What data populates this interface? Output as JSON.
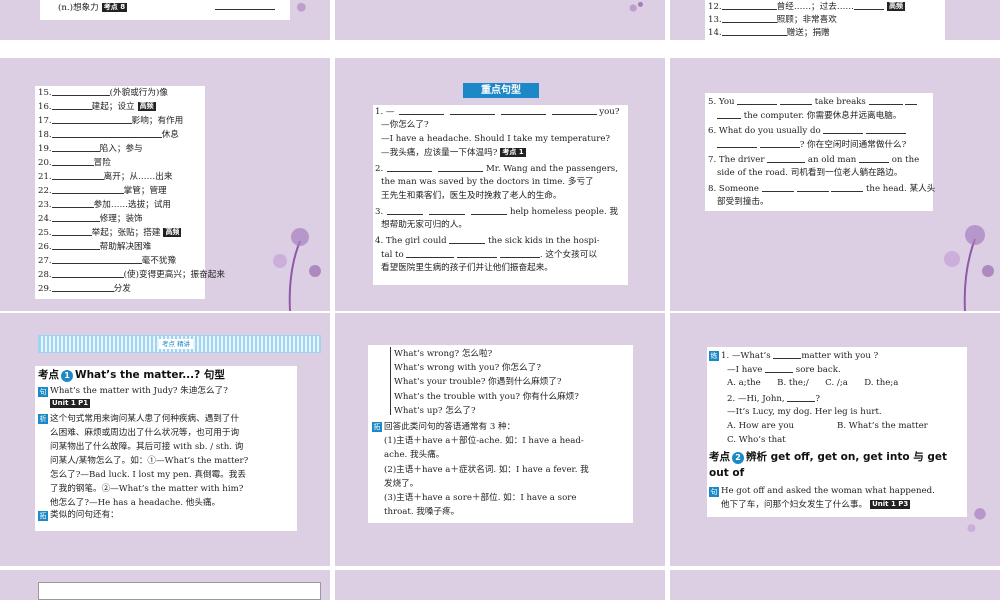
{
  "colors": {
    "slide_bg": "#dccfe3",
    "accent_blue": "#1d88c8",
    "deco_purple": "#8e5aa8"
  },
  "slide1": {
    "line_a": "(n.)想象力",
    "tag_a": "考点 8"
  },
  "slide3": {
    "l12": "12.",
    "l12_text": "曾经……；过去……",
    "l12_tag": "高频",
    "l13": "13.",
    "l13_text": "照顾；非常喜欢",
    "l14": "14.",
    "l14_text": "赠送；捐赠"
  },
  "slide4": {
    "items": [
      {
        "n": "15.",
        "text": "(外貌或行为)像"
      },
      {
        "n": "16.",
        "text": "建起；设立",
        "tag": "高频"
      },
      {
        "n": "17.",
        "text": "影响；有作用"
      },
      {
        "n": "18.",
        "text": "休息"
      },
      {
        "n": "19.",
        "text": "陷入；参与"
      },
      {
        "n": "20.",
        "text": "冒险"
      },
      {
        "n": "21.",
        "text": "离开；从……出来"
      },
      {
        "n": "22.",
        "text": "掌管；管理"
      },
      {
        "n": "23.",
        "text": "参加……选拔；试用"
      },
      {
        "n": "24.",
        "text": "修理；装饰"
      },
      {
        "n": "25.",
        "text": "举起；张贴；搭建",
        "tag": "高频"
      },
      {
        "n": "26.",
        "text": "帮助解决困难"
      },
      {
        "n": "27.",
        "text": "毫不犹豫"
      },
      {
        "n": "28.",
        "text": "(使)变得更高兴；振奋起来"
      },
      {
        "n": "29.",
        "text": "分发"
      }
    ]
  },
  "slide5": {
    "section_title": "重点句型",
    "s1_a": "1. —",
    "s1_b": "you?",
    "s1_c": "—你怎么了?",
    "s1_d": "—I have a headache. Should I take my temperature?",
    "s1_e": "—我头痛，应该量一下体温吗?",
    "s1_tag": "考点 1",
    "s2_a": "2.",
    "s2_b": "Mr. Wang and the passengers,",
    "s2_c": "the man was saved by the doctors in time. 多亏了",
    "s2_d": "王先生和乘客们，医生及时挽救了老人的生命。",
    "s3_a": "3.",
    "s3_b": "help homeless people. 我",
    "s3_c": "想帮助无家可归的人。",
    "s4_a": "4. The girl could",
    "s4_b": "the sick kids in the hospi-",
    "s4_c": "tal to",
    "s4_d": ". 这个女孩可以",
    "s4_e": "看望医院里生病的孩子们并让他们振奋起来。"
  },
  "slide6": {
    "s5_a": "5. You",
    "s5_b": "take breaks",
    "s5_c": "the computer. 你需要休息并远离电脑。",
    "s6_a": "6. What do you usually do",
    "s6_b": "? 你在空闲时间通常做什么?",
    "s7_a": "7. The driver",
    "s7_b": "an old man",
    "s7_c": "on the",
    "s7_d": "side of the road. 司机看到一位老人躺在路边。",
    "s8_a": "8. Someone",
    "s8_b": "the head. 某人头",
    "s8_c": "部受到撞击。"
  },
  "slide7": {
    "banner_label": "考点 精讲",
    "point_title_a": "考点",
    "point_num": "1",
    "point_title_b": "What’s the matter...? 句型",
    "ex_icon": "句",
    "ex_text": "What’s the matter with Judy? 朱迪怎么了?",
    "ex_tag": "Unit 1 P1",
    "an_icon": "析",
    "an_lines": [
      "这个句式常用来询问某人患了何种疾病、遇到了什",
      "么困难、麻烦或周边出了什么状况等，也可用于询",
      "问某物出了什么故障。其后可接 with sb. / sth. 询",
      "问某人/某物怎么了。如：①—What’s the matter?",
      "怎么了?—Bad luck. I lost my pen. 真倒霉。我丢",
      "了我的钢笔。②—What’s the matter with him?",
      "他怎么了?—He has a headache. 他头痛。"
    ],
    "ext_icon": "拓",
    "ext_text": "类似的问句还有："
  },
  "slide8": {
    "q_lines": [
      "What’s wrong? 怎么啦?",
      "What’s wrong with you? 你怎么了?",
      "What’s your trouble? 你遇到什么麻烦了?",
      "What’s the trouble with you? 你有什么麻烦?",
      "What’s up? 怎么了?"
    ],
    "ext_icon": "拓",
    "body_lines": [
      "回答此类问句的答语通常有 3 种：",
      "(1)主语＋have a＋部位-ache. 如：I have a head-",
      "ache. 我头痛。",
      "(2)主语＋have a＋症状名词. 如：I have a fever. 我",
      "发烧了。",
      "(3)主语＋have a sore＋部位. 如：I have a sore",
      "throat. 我嗓子疼。"
    ]
  },
  "slide9": {
    "pr_icon": "练",
    "q1_a": "1. —What’s",
    "q1_b": "matter with you ?",
    "q1_c": "—I have",
    "q1_d": "sore back.",
    "q1_opts": "A. a;the      B. the;/      C. /;a      D. the;a",
    "q2_a": "2. —Hi, John,",
    "q2_b": "?",
    "q2_c": "—It’s Lucy, my dog. Her leg is hurt.",
    "q2_opt_a": "A. How are you",
    "q2_opt_b": "B. What’s the matter",
    "q2_opt_c": "C. Who’s that",
    "point_title_a": "考点",
    "point_num": "2",
    "point_title_b": "辨析 get off, get on, get into 与 get out of",
    "ex_icon": "句",
    "ex_line1": "He got off and asked the woman what happened.",
    "ex_line2": "他下了车，问那个妇女发生了什么事。",
    "ex_tag": "Unit 1 P3"
  }
}
